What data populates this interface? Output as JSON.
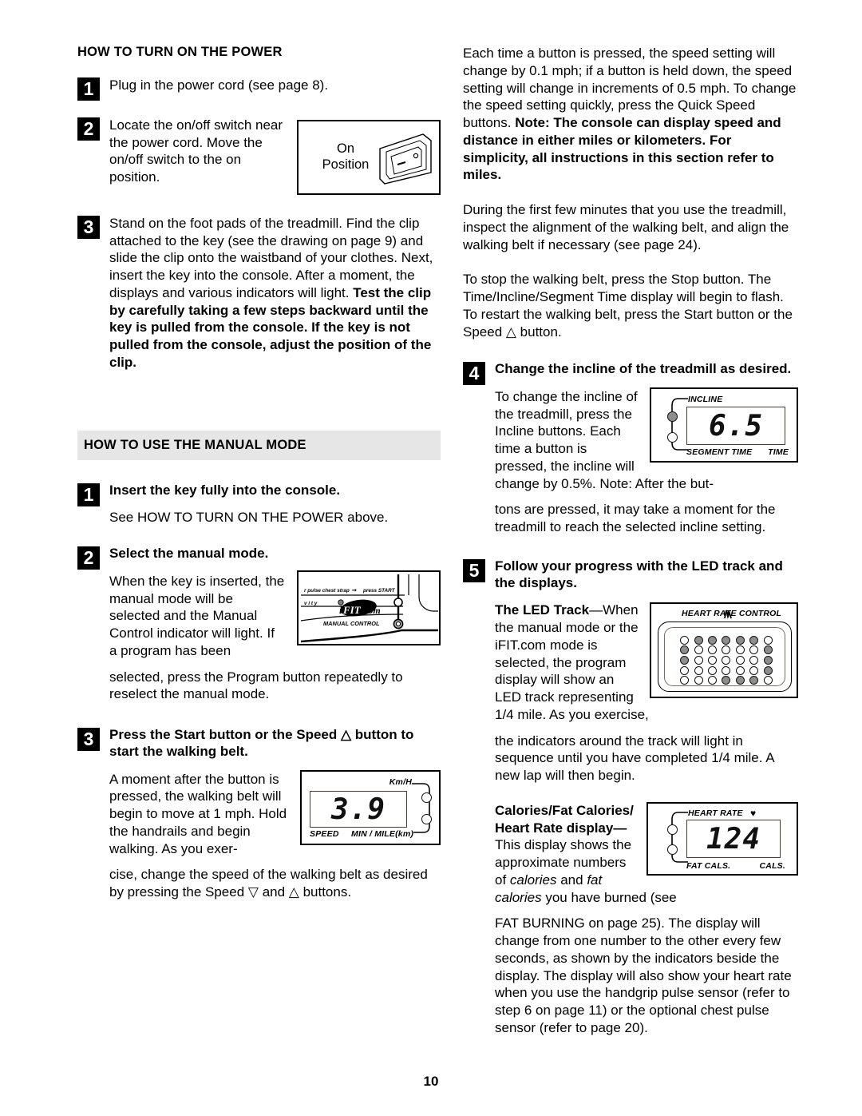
{
  "page": {
    "number": "10"
  },
  "left_column": {
    "section1": {
      "heading": "HOW TO TURN ON THE POWER",
      "steps": [
        {
          "num": "1",
          "text": "Plug in the power cord (see page 8)."
        },
        {
          "num": "2",
          "text": "Locate the on/off switch near the power cord. Move the on/off switch to the on position."
        },
        {
          "num": "3",
          "text_plain": "Stand on the foot pads of the treadmill. Find the clip attached to the key (see the drawing on page 9) and slide the clip onto the waistband of your clothes. Next, insert the key into the console. After a moment, the displays and various indicators will light. ",
          "text_bold": "Test the clip by carefully taking a few steps backward until the key is pulled from the console. If the key is not pulled from the console, adjust the position of the clip."
        }
      ],
      "switch_figure": {
        "label_line1": "On",
        "label_line2": "Position",
        "icon": "rocker-switch-drawing"
      }
    },
    "section2": {
      "heading": "HOW TO USE THE MANUAL MODE",
      "steps": [
        {
          "num": "1",
          "title": "Insert the key fully into the console.",
          "body": "See HOW TO TURN ON THE POWER above."
        },
        {
          "num": "2",
          "title": "Select the manual mode.",
          "body_wrapped": "When the key is inserted, the manual mode will be selected and the Manual Control indicator will light. If a program has been",
          "body_rest": "selected, press the Program button repeatedly to reselect the manual mode."
        },
        {
          "num": "3",
          "title": "Press the Start button or the Speed △ button to start the walking belt.",
          "body_wrapped": "A moment after the button is pressed, the walking belt will begin to move at 1 mph. Hold the handrails and begin walking. As you exer-",
          "body_rest": "cise, change the speed of the walking belt as desired by pressing the Speed ▽ and △ buttons."
        }
      ],
      "ifit_figure": {
        "line_top": "r pulse chest strap",
        "line_top_end": "press START",
        "line_mid": "v  i  t  y",
        "logo": "iFIT.com",
        "manual_control_label": "MANUAL CONTROL"
      },
      "speed_figure": {
        "value": "3.9",
        "unit_top": "Km/H",
        "label_left": "SPEED",
        "label_right": "MIN / MILE(km)"
      }
    }
  },
  "right_column": {
    "paragraphs": [
      {
        "plain": "Each time a button is pressed, the speed setting will change by 0.1 mph; if a button is held down, the speed setting will change in increments of 0.5 mph. To change the speed setting quickly, press the Quick Speed buttons. ",
        "bold": "Note: The console can display speed and distance in either miles or kilometers. For simplicity, all instructions in this section refer to miles."
      },
      {
        "plain": "During the first few minutes that you use the treadmill, inspect the alignment of the walking belt, and align the walking belt if necessary (see page 24)."
      },
      {
        "plain": "To stop the walking belt, press the Stop button. The Time/Incline/Segment Time display will begin to flash. To restart the walking belt, press the Start button or the Speed △ button."
      }
    ],
    "steps": [
      {
        "num": "4",
        "title": "Change the incline of the treadmill as desired.",
        "body_wrapped": "To change the incline of the treadmill, press the Incline buttons. Each time a button is pressed, the incline will change by 0.5%. Note: After the but-",
        "body_rest": "tons are pressed, it may take a moment for the treadmill to reach the selected incline setting."
      },
      {
        "num": "5",
        "title": "Follow your progress with the LED track and the displays.",
        "sub1_bold": "The LED Track",
        "sub1_dash": "—",
        "sub1_wrapped": "When the manual mode or the iFIT.com mode is selected, the program display will show an LED track representing 1/4 mile. As you exercise,",
        "sub1_rest": "the indicators around the track will light in sequence until you have completed 1/4 mile. A new lap will then begin.",
        "sub2_bold": "Calories/Fat Calories/ Heart Rate display",
        "sub2_dash": "—",
        "sub2_part1": "This display shows the approximate numbers of ",
        "sub2_italic1": "calories",
        "sub2_part2": " and ",
        "sub2_italic2": "fat calories",
        "sub2_part3": " you have burned (see",
        "sub2_rest": "FAT BURNING on page 25). The display will change from one number to the other every few seconds, as shown by the indicators beside the display. The display will also show your heart rate when you use the handgrip pulse sensor (refer to step 6 on page 11) or the optional chest pulse sensor (refer to page 20)."
      }
    ],
    "incline_figure": {
      "value": "6.5",
      "label_top": "INCLINE",
      "label_bottom_left": "SEGMENT TIME",
      "label_bottom_right": "TIME",
      "indicator_top_state": "filled",
      "indicator_bottom_state": "empty"
    },
    "led_figure": {
      "title": "HEART RATE CONTROL",
      "rows": [
        [
          0,
          1,
          1,
          1,
          1,
          1,
          0
        ],
        [
          1,
          0,
          0,
          0,
          0,
          0,
          1
        ],
        [
          1,
          0,
          0,
          0,
          0,
          0,
          1
        ],
        [
          0,
          0,
          0,
          0,
          0,
          0,
          1
        ],
        [
          0,
          0,
          0,
          1,
          1,
          1,
          0
        ]
      ]
    },
    "heart_rate_figure": {
      "value": "124",
      "label_top": "HEART RATE",
      "heart_glyph": "♥",
      "label_bottom_left": "FAT CALS.",
      "label_bottom_right": "CALS.",
      "indicator_top_state": "empty",
      "indicator_bottom_state": "empty"
    }
  }
}
